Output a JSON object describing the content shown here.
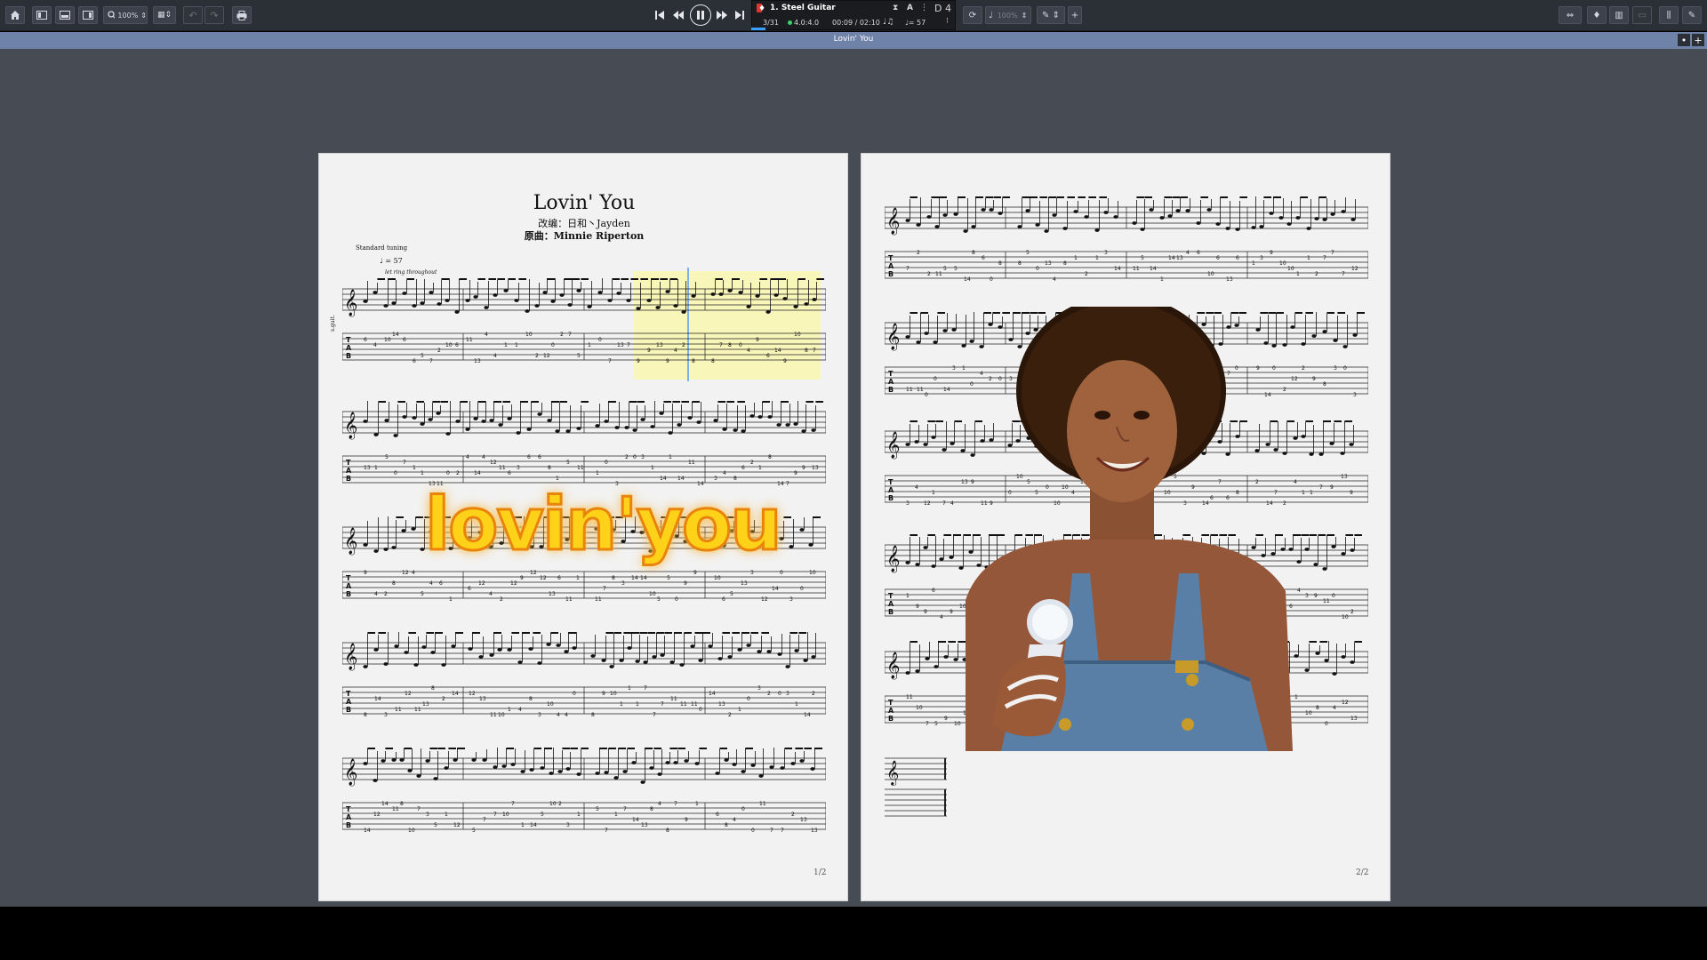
{
  "toolbar": {
    "zoom_value": "100%",
    "transport_time_display": "3/31",
    "lcd": {
      "track_name": "1. Steel Guitar",
      "bar_position": "3/31",
      "time_signature": "4.0:4.0",
      "time": "00:09 / 02:10",
      "tempo": "♩= 57",
      "key": "D 4",
      "note_value": "♩♫"
    },
    "speed_value": "100%"
  },
  "tab": {
    "title": "Lovin' You",
    "close_icon": "close-icon",
    "add_icon": "plus-icon"
  },
  "score": {
    "title": "Lovin' You",
    "arranger_line": "改编：日和丶Jayden",
    "original_line": "原曲：Minnie Riperton",
    "tuning": "Standard tuning",
    "tempo_mark": "♩ = 57",
    "performance_note": "let ring throughout",
    "instrument_label": "s.guit."
  },
  "pages": [
    {
      "number_label": "1/2"
    },
    {
      "number_label": "2/2"
    }
  ],
  "overlay": {
    "text": "lovin'you"
  },
  "colors": {
    "toolbar_bg": "#2b2f36",
    "tab_bar_bg": "#6f83a8",
    "workspace_bg": "#464b54",
    "page_bg": "#f2f2f2",
    "selection_highlight": "#fffa8c",
    "overlay_fill": "#ffd21a",
    "overlay_outline": "#e8840e"
  }
}
